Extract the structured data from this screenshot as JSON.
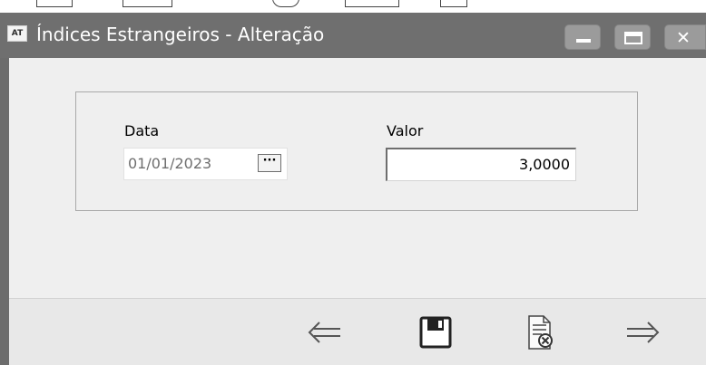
{
  "window": {
    "icon_label": "AT",
    "title": "Índices Estrangeiros - Alteração"
  },
  "form": {
    "data_label": "Data",
    "data_value": "01/01/2023",
    "data_picker_label": "···",
    "valor_label": "Valor",
    "valor_value": "3,0000"
  },
  "toolbar": {
    "buttons": [
      "previous-arrow-icon",
      "save-icon",
      "cancel-document-icon",
      "next-arrow-icon"
    ]
  }
}
